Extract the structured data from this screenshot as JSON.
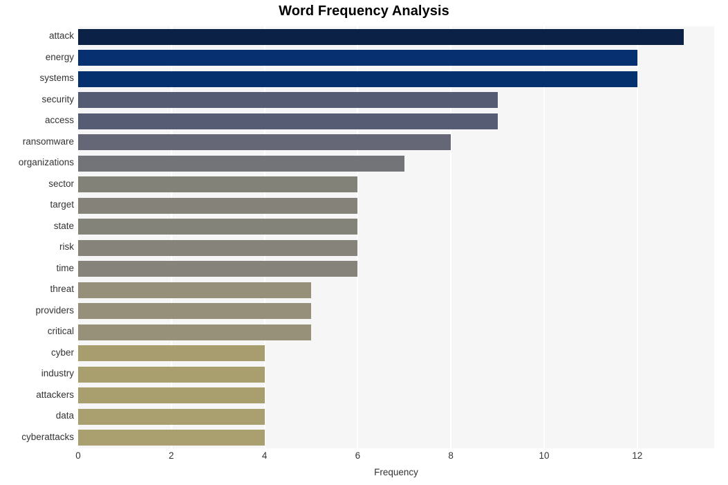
{
  "chart_data": {
    "type": "bar",
    "orientation": "horizontal",
    "title": "Word Frequency Analysis",
    "xlabel": "Frequency",
    "ylabel": "",
    "xlim": [
      0,
      13.65
    ],
    "xticks": [
      0,
      2,
      4,
      6,
      8,
      10,
      12
    ],
    "xtick_labels": [
      "0",
      "2",
      "4",
      "6",
      "8",
      "10",
      "12"
    ],
    "grid": "vertical-only",
    "legend": "none",
    "categories": [
      "attack",
      "energy",
      "systems",
      "security",
      "access",
      "ransomware",
      "organizations",
      "sector",
      "target",
      "state",
      "risk",
      "time",
      "threat",
      "providers",
      "critical",
      "cyber",
      "industry",
      "attackers",
      "data",
      "cyberattacks"
    ],
    "values": [
      13,
      12,
      12,
      9,
      9,
      8,
      7,
      6,
      6,
      6,
      6,
      6,
      5,
      5,
      5,
      4,
      4,
      4,
      4,
      4
    ],
    "bar_colors": [
      "#0b2146",
      "#06306f",
      "#06316f",
      "#555b72",
      "#565c73",
      "#656676",
      "#737477",
      "#838279",
      "#848279",
      "#84837a",
      "#85837a",
      "#85837a",
      "#96907a",
      "#96907a",
      "#979179",
      "#a89d6f",
      "#a99e6e",
      "#a99e6e",
      "#aa9f6e",
      "#aa9f6e"
    ],
    "plot_background": "#f6f6f7",
    "gridline_color": "#ffffff",
    "title_color": "#000000",
    "tick_label_color": "#333333"
  }
}
